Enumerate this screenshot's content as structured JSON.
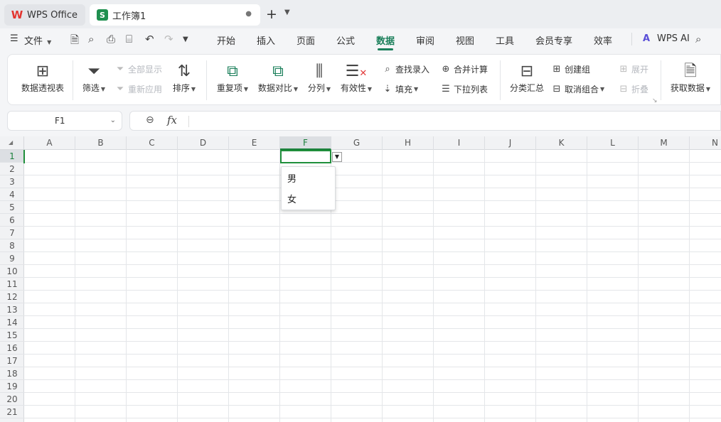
{
  "tabs": {
    "app_label": "WPS Office",
    "workbook_label": "工作簿1",
    "workbook_icon_letter": "S",
    "new_tab": "+"
  },
  "menu": {
    "file": "文件",
    "items": [
      "开始",
      "插入",
      "页面",
      "公式",
      "数据",
      "审阅",
      "视图",
      "工具",
      "会员专享",
      "效率"
    ],
    "active": "数据",
    "wps_ai": "WPS AI"
  },
  "ribbon": {
    "pivot": "数据透视表",
    "filter": "筛选",
    "show_all": "全部显示",
    "reapply": "重新应用",
    "sort": "排序",
    "duplicates": "重复项",
    "compare": "数据对比",
    "split": "分列",
    "validity": "有效性",
    "lookup": "查找录入",
    "fill": "填充",
    "consolidate": "合并计算",
    "dropdown_list": "下拉列表",
    "subtotal": "分类汇总",
    "create_group": "创建组",
    "ungroup": "取消组合",
    "expand": "展开",
    "collapse": "折叠",
    "get_data": "获取数据"
  },
  "formula_bar": {
    "name_box": "F1",
    "fx": "fx",
    "value": ""
  },
  "sheet": {
    "columns": [
      "A",
      "B",
      "C",
      "D",
      "E",
      "F",
      "G",
      "H",
      "I",
      "J",
      "K",
      "L",
      "M",
      "N"
    ],
    "rows": [
      "1",
      "2",
      "3",
      "4",
      "5",
      "6",
      "7",
      "8",
      "9",
      "10",
      "11",
      "12",
      "13",
      "14",
      "15",
      "16",
      "17",
      "18",
      "19",
      "20",
      "21"
    ],
    "selected_column": "F",
    "selected_row": "1"
  },
  "dropdown": {
    "options": [
      "男",
      "女"
    ]
  },
  "colors": {
    "accent": "#1a7f5a",
    "selection": "#1f8f3b",
    "sheet_icon": "#1f8f4f",
    "wps_logo": "#e3342f"
  }
}
